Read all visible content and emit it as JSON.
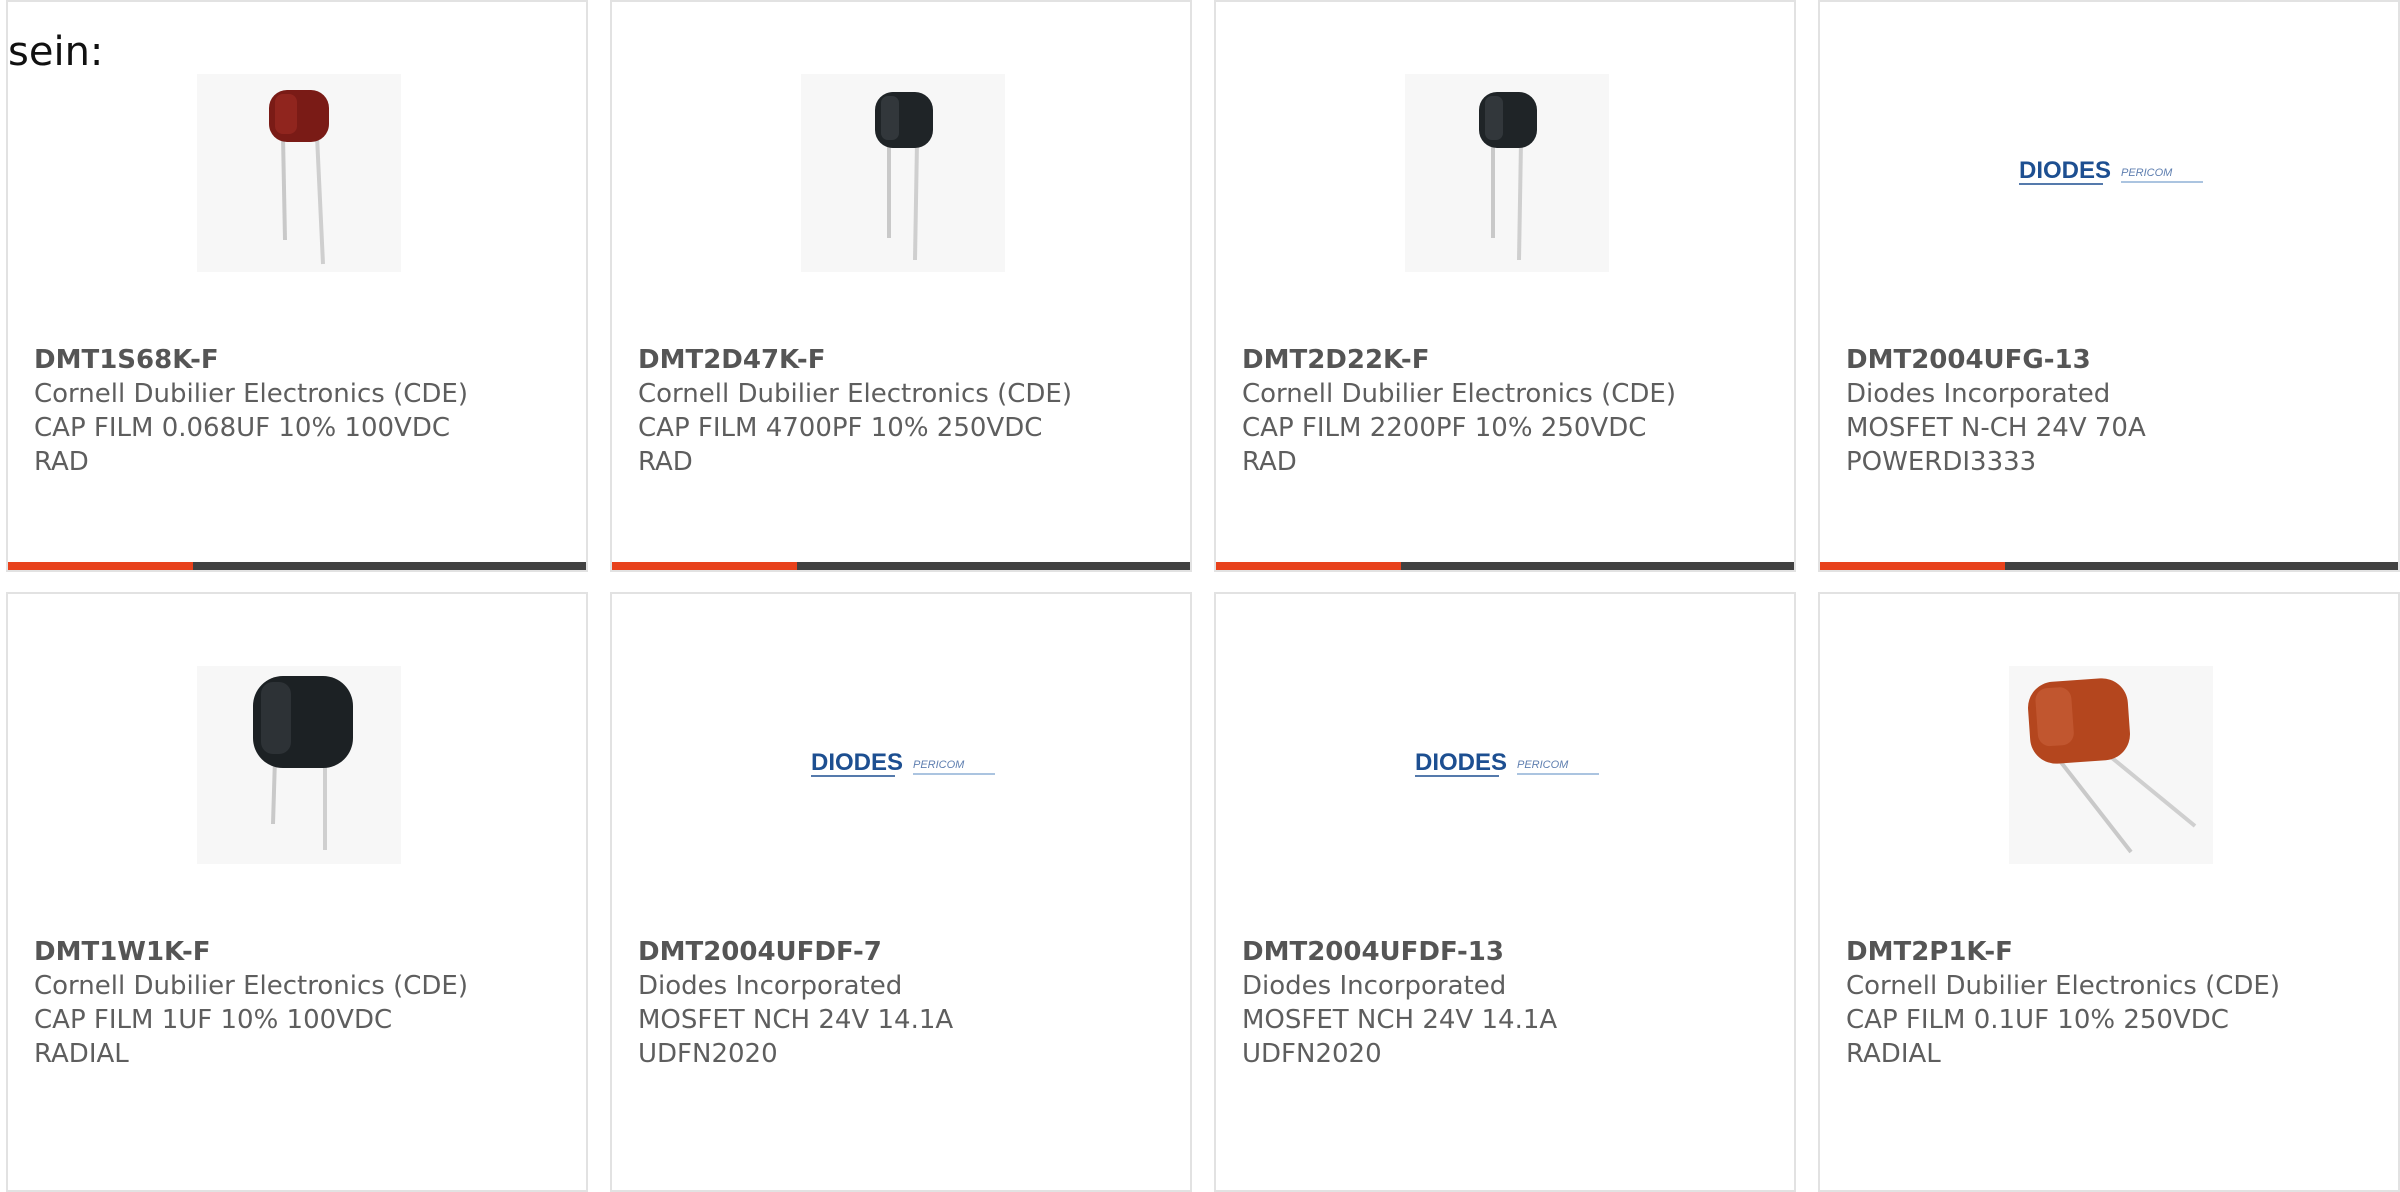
{
  "intro_text": "sein:",
  "accent_color": "#e8421c",
  "bar_color": "#414141",
  "products": [
    {
      "part_number": "DMT1S68K-F",
      "manufacturer": "Cornell Dubilier Electronics (CDE)",
      "description_line1": "CAP FILM 0.068UF 10% 100VDC",
      "description_line2": "RAD",
      "image": "red-film-capacitor-image",
      "progress_fraction": 0.32
    },
    {
      "part_number": "DMT2D47K-F",
      "manufacturer": "Cornell Dubilier Electronics (CDE)",
      "description_line1": "CAP FILM 4700PF 10% 250VDC",
      "description_line2": "RAD",
      "image": "black-film-capacitor-image",
      "progress_fraction": 0.32
    },
    {
      "part_number": "DMT2D22K-F",
      "manufacturer": "Cornell Dubilier Electronics (CDE)",
      "description_line1": "CAP FILM 2200PF 10% 250VDC",
      "description_line2": "RAD",
      "image": "black-film-capacitor-image",
      "progress_fraction": 0.32
    },
    {
      "part_number": "DMT2004UFG-13",
      "manufacturer": "Diodes Incorporated",
      "description_line1": "MOSFET N-CH 24V 70A",
      "description_line2": "POWERDI3333",
      "image": "diodes-pericom-logo-image",
      "logo_text_1": "DIODES",
      "logo_text_2": "PERICOM",
      "progress_fraction": 0.32
    },
    {
      "part_number": "DMT1W1K-F",
      "manufacturer": "Cornell Dubilier Electronics (CDE)",
      "description_line1": "CAP FILM 1UF 10% 100VDC",
      "description_line2": "RADIAL",
      "image": "black-film-capacitor-large-image"
    },
    {
      "part_number": "DMT2004UFDF-7",
      "manufacturer": "Diodes Incorporated",
      "description_line1": "MOSFET NCH 24V 14.1A",
      "description_line2": "UDFN2020",
      "image": "diodes-pericom-logo-image",
      "logo_text_1": "DIODES",
      "logo_text_2": "PERICOM"
    },
    {
      "part_number": "DMT2004UFDF-13",
      "manufacturer": "Diodes Incorporated",
      "description_line1": "MOSFET NCH 24V 14.1A",
      "description_line2": "UDFN2020",
      "image": "diodes-pericom-logo-image",
      "logo_text_1": "DIODES",
      "logo_text_2": "PERICOM"
    },
    {
      "part_number": "DMT2P1K-F",
      "manufacturer": "Cornell Dubilier Electronics (CDE)",
      "description_line1": "CAP FILM 0.1UF 10% 250VDC",
      "description_line2": "RADIAL",
      "image": "orange-film-capacitor-image"
    }
  ]
}
